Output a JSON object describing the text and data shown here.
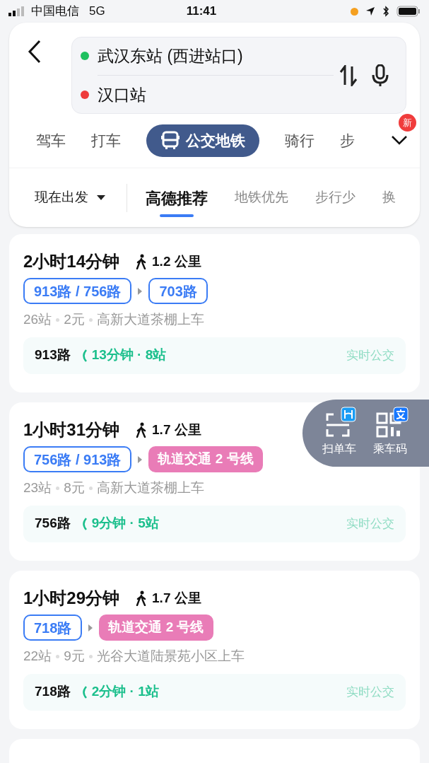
{
  "status_bar": {
    "carrier": "中国电信",
    "network": "5G",
    "time": "11:41"
  },
  "search": {
    "origin": "武汉东站 (西进站口)",
    "destination": "汉口站"
  },
  "modes": [
    {
      "label": "驾车",
      "selected": false
    },
    {
      "label": "打车",
      "selected": false
    },
    {
      "label": "公交地铁",
      "selected": true
    },
    {
      "label": "骑行",
      "selected": false
    },
    {
      "label": "步",
      "selected": false
    }
  ],
  "more_badge": "新",
  "depart": "现在出发",
  "sorts": [
    {
      "label": "高德推荐",
      "selected": true
    },
    {
      "label": "地铁优先",
      "selected": false
    },
    {
      "label": "步行少",
      "selected": false
    },
    {
      "label": "换",
      "selected": false
    }
  ],
  "routes": [
    {
      "duration": "2小时14分钟",
      "walk": "1.2 公里",
      "lines": [
        {
          "kind": "bus",
          "label": "913路 / 756路"
        },
        {
          "kind": "bus",
          "label": "703路"
        }
      ],
      "details": [
        "26站",
        "2元",
        "高新大道茶棚上车"
      ],
      "realtime": {
        "route": "913路",
        "info": "13分钟 · 8站",
        "label": "实时公交"
      }
    },
    {
      "duration": "1小时31分钟",
      "walk": "1.7 公里",
      "lines": [
        {
          "kind": "bus",
          "label": "756路 / 913路"
        },
        {
          "kind": "rail",
          "label": "轨道交通 2 号线"
        }
      ],
      "details": [
        "23站",
        "8元",
        "高新大道茶棚上车"
      ],
      "realtime": {
        "route": "756路",
        "info": "9分钟 · 5站",
        "label": "实时公交"
      }
    },
    {
      "duration": "1小时29分钟",
      "walk": "1.7 公里",
      "lines": [
        {
          "kind": "bus",
          "label": "718路"
        },
        {
          "kind": "rail",
          "label": "轨道交通 2 号线"
        }
      ],
      "details": [
        "22站",
        "9元",
        "光谷大道陆景苑小区上车"
      ],
      "realtime": {
        "route": "718路",
        "info": "2分钟 · 1站",
        "label": "实时公交"
      }
    }
  ],
  "quick_actions": [
    {
      "label": "扫单车"
    },
    {
      "label": "乘车码"
    }
  ]
}
